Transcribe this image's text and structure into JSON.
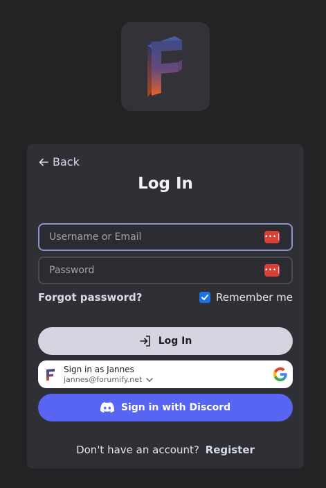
{
  "logo": {
    "icon": "forumify-f-logo"
  },
  "login": {
    "back_label": "Back",
    "title": "Log In",
    "username_placeholder": "Username or Email",
    "password_placeholder": "Password",
    "password_manager_icon": "key-dots-icon",
    "forgot_label": "Forgot password?",
    "remember_label": "Remember me",
    "remember_checked": true,
    "submit_label": "Log In"
  },
  "google": {
    "title": "Sign in as Jannes",
    "email": "jannes@forumify.net"
  },
  "discord": {
    "label": "Sign in with Discord"
  },
  "footer": {
    "prompt": "Don't have an account?",
    "register_label": "Register"
  },
  "colors": {
    "background": "#232326",
    "card": "#2f3035",
    "accent_discord": "#5865f2",
    "focus_border": "#8f95c9",
    "password_badge": "#d9403a",
    "checkbox": "#1a73e8"
  }
}
